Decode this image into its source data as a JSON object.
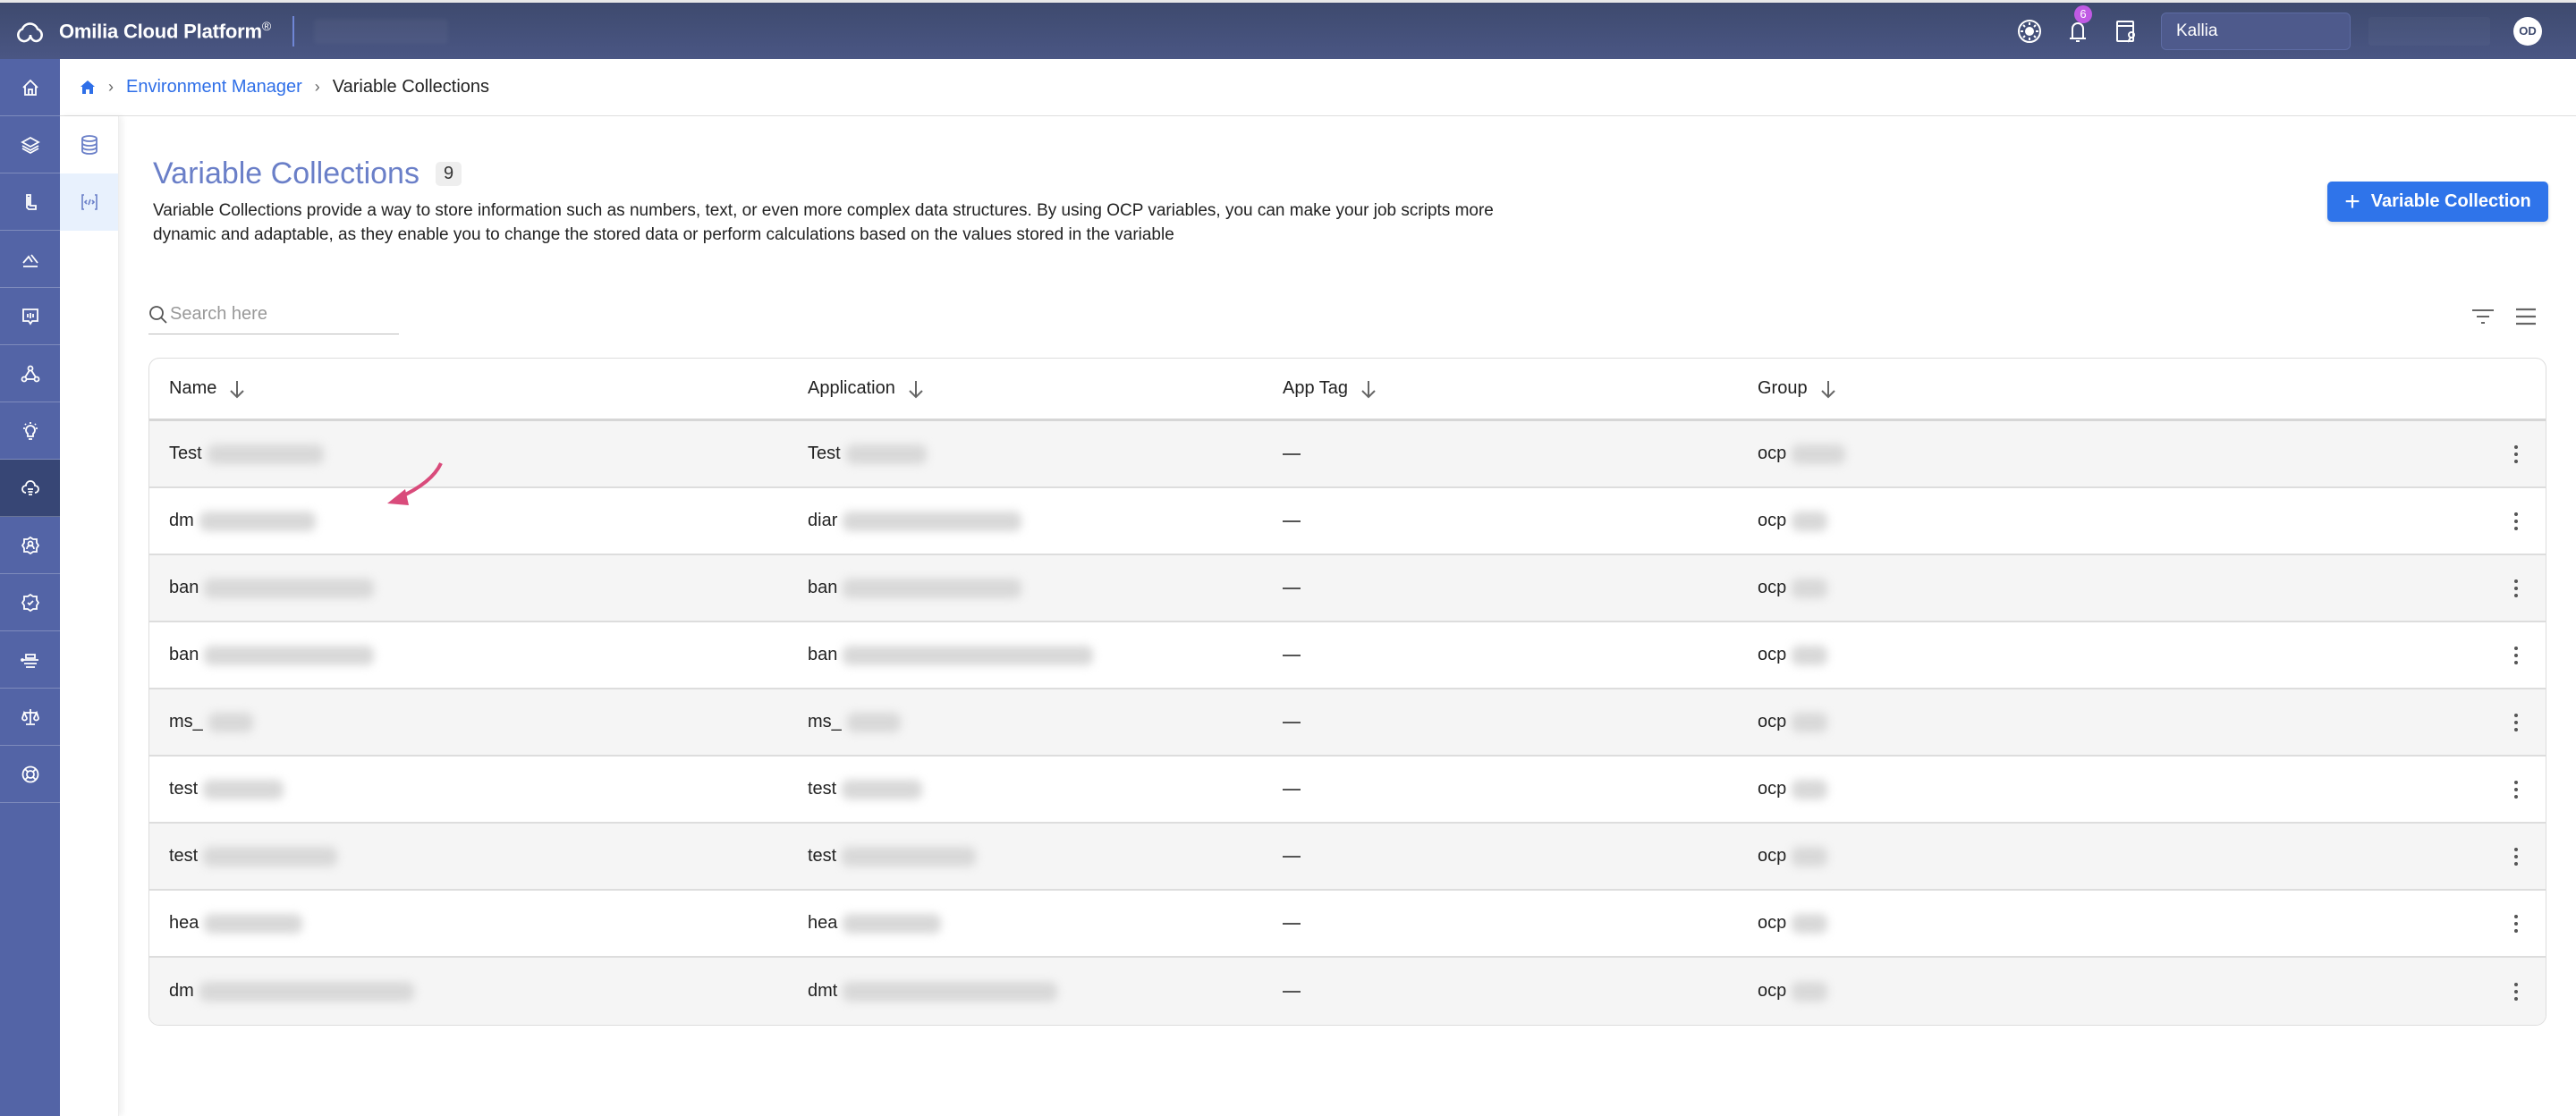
{
  "topbar": {
    "brand": "Omilia Cloud Platform",
    "brand_mark": "®",
    "notifications_count": "6",
    "environment": "Kallia",
    "avatar_initials": "OD"
  },
  "rail": {
    "items": [
      {
        "icon": "home-icon"
      },
      {
        "icon": "layers-icon"
      },
      {
        "icon": "deploy-icon"
      },
      {
        "icon": "analytics-icon"
      },
      {
        "icon": "monitor-icon"
      },
      {
        "icon": "flow-icon"
      },
      {
        "icon": "lightbulb-icon"
      },
      {
        "icon": "cloud-environment-icon",
        "active": true
      },
      {
        "icon": "user-settings-icon"
      },
      {
        "icon": "security-icon"
      },
      {
        "icon": "integrations-icon"
      },
      {
        "icon": "legal-icon"
      },
      {
        "icon": "support-icon"
      }
    ]
  },
  "subnav": {
    "items": [
      {
        "icon": "database-icon"
      },
      {
        "icon": "variables-icon",
        "active": true
      }
    ]
  },
  "breadcrumb": {
    "items": [
      "Environment Manager",
      "Variable Collections"
    ]
  },
  "page": {
    "title": "Variable Collections",
    "count": "9",
    "description": "Variable Collections provide a way to store information such as numbers, text, or even more complex data structures. By using OCP variables, you can make your job scripts more dynamic and adaptable, as they enable you to change the stored data or perform calculations based on the values stored in the variable",
    "add_button": "Variable Collection",
    "search_placeholder": "Search here"
  },
  "table": {
    "columns": [
      "Name",
      "Application",
      "App Tag",
      "Group"
    ],
    "rows": [
      {
        "name": "Test",
        "application": "Test",
        "app_tag": "—",
        "group": "ocp"
      },
      {
        "name": "dm",
        "application": "diar",
        "app_tag": "—",
        "group": "ocp"
      },
      {
        "name": "ban",
        "application": "ban",
        "app_tag": "—",
        "group": "ocp"
      },
      {
        "name": "ban",
        "application": "ban",
        "app_tag": "—",
        "group": "ocp"
      },
      {
        "name": "ms_",
        "application": "ms_",
        "app_tag": "—",
        "group": "ocp"
      },
      {
        "name": "test",
        "application": "test",
        "app_tag": "—",
        "group": "ocp"
      },
      {
        "name": "test",
        "application": "test",
        "app_tag": "—",
        "group": "ocp"
      },
      {
        "name": "hea",
        "application": "hea",
        "app_tag": "—",
        "group": "ocp"
      },
      {
        "name": "dm",
        "application": "dmt",
        "app_tag": "—",
        "group": "ocp"
      }
    ]
  },
  "colors": {
    "accent": "#2f74ea",
    "rail": "#5364a6",
    "title": "#6a7fc8",
    "annotation": "#d94b7b"
  }
}
